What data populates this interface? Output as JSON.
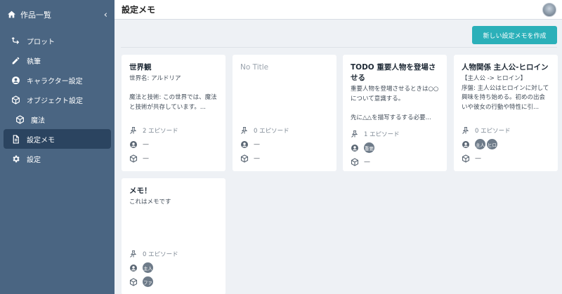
{
  "sidebar": {
    "header": "作品一覧",
    "items": [
      {
        "label": "プロット"
      },
      {
        "label": "執筆"
      },
      {
        "label": "キャラクター設定"
      },
      {
        "label": "オブジェクト設定"
      },
      {
        "label": "魔法"
      },
      {
        "label": "設定メモ"
      },
      {
        "label": "設定"
      }
    ]
  },
  "header": {
    "title": "設定メモ"
  },
  "create_button": "新しい設定メモを作成",
  "cards": [
    {
      "title": "世界観",
      "body": "世界名: アルドリア\n\n魔法と技術: この世界では、魔法と技術が共存しています。...",
      "episodes": "2 エピソード",
      "characters": "—",
      "objects": "—"
    },
    {
      "title": "No Title",
      "body": "",
      "episodes": "0 エピソード",
      "characters": "—",
      "objects": "—"
    },
    {
      "title": "TODO 重要人物を登場させる",
      "body": "重要人物を登場させるときは○○について意識する。\n\n先に△△を描写するする必要...",
      "episodes": "1 エピソード",
      "character_chips": [
        "重要"
      ],
      "objects": "—"
    },
    {
      "title": "人物関係 主人公-ヒロイン",
      "body": "【主人公 -> ヒロイン】\n序盤: 主人公はヒロインに対して興味を持ち始める。初めの出会いや彼女の行動や特性に引...",
      "episodes": "0 エピソード",
      "character_chips": [
        "主人",
        "ヒロ"
      ],
      "objects": "—"
    },
    {
      "title": "メモ！",
      "body": "これはメモです",
      "episodes": "0 エピソード",
      "character_chips": [
        "主人"
      ],
      "object_chips": [
        "ファ"
      ]
    }
  ]
}
